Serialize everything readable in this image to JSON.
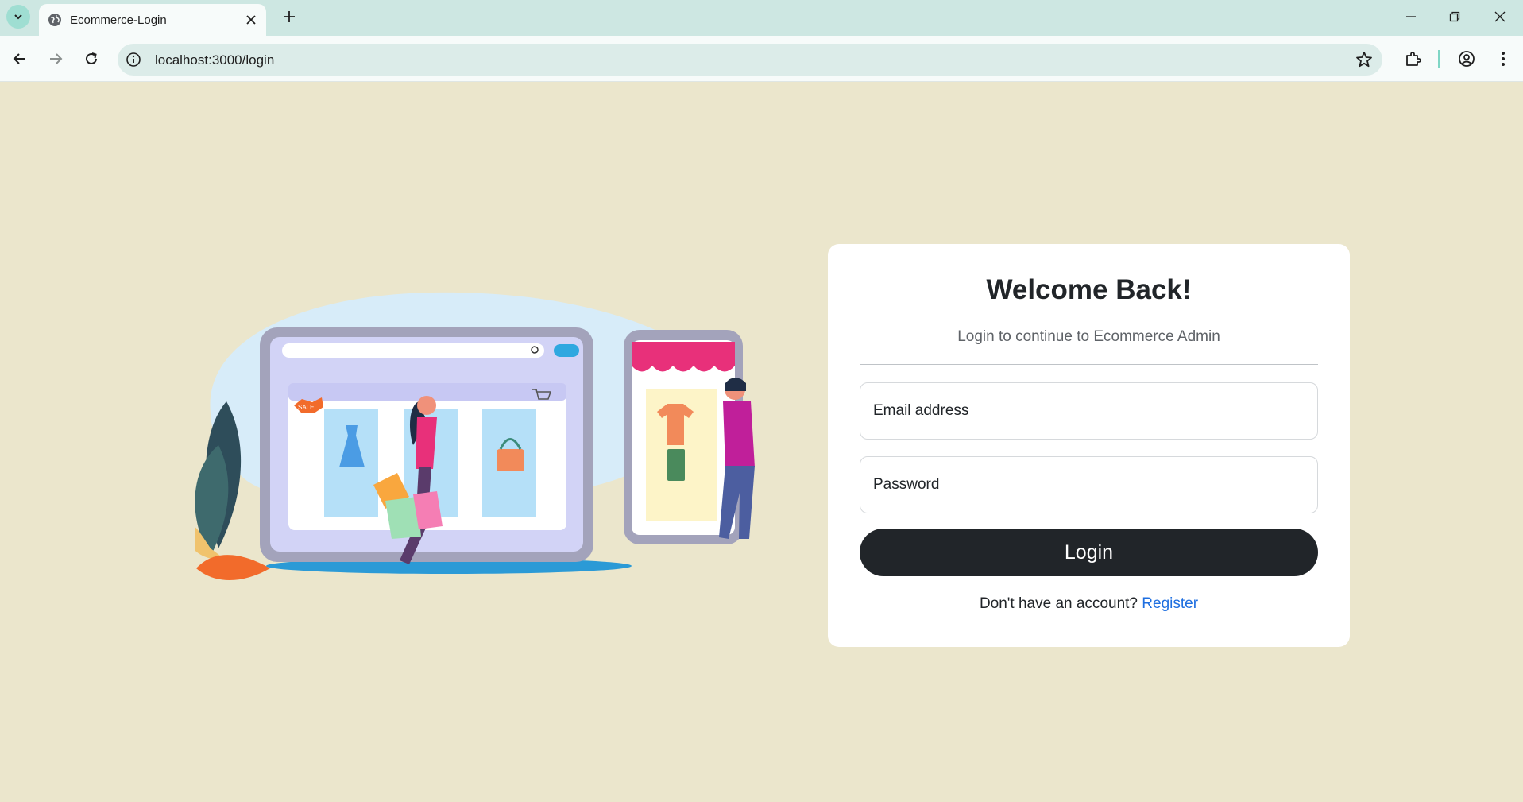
{
  "browser": {
    "tab_title": "Ecommerce-Login",
    "url": "localhost:3000/login"
  },
  "login_card": {
    "title": "Welcome Back!",
    "subtitle": "Login to continue to Ecommerce Admin",
    "email_placeholder": "Email address",
    "password_placeholder": "Password",
    "login_button": "Login",
    "register_prompt": "Don't have an account?",
    "register_link": "Register"
  },
  "illustration": {
    "sale_badge": "SALE"
  },
  "colors": {
    "page_background": "#ebe6cc",
    "card_background": "#ffffff",
    "button_dark": "#212529",
    "link_blue": "#1f6fe0",
    "chrome_tabbar": "#cde7e2"
  },
  "icons": {
    "tab_search": "chevron-down-icon",
    "favicon": "globe-icon",
    "close": "close-icon",
    "new_tab": "plus-icon",
    "back": "arrow-left-icon",
    "forward": "arrow-right-icon",
    "reload": "reload-icon",
    "site_info": "info-icon",
    "bookmark": "star-icon",
    "extensions": "puzzle-icon",
    "profile": "account-icon",
    "menu": "kebab-menu-icon"
  }
}
